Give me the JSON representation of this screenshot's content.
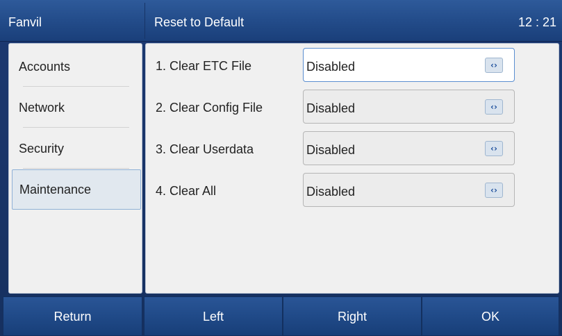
{
  "header": {
    "brand": "Fanvil",
    "title": "Reset to Default",
    "clock": "12 : 21"
  },
  "sidebar": {
    "items": [
      {
        "label": "Accounts"
      },
      {
        "label": "Network"
      },
      {
        "label": "Security"
      },
      {
        "label": "Maintenance",
        "active": true
      }
    ]
  },
  "main": {
    "rows": [
      {
        "label": "1. Clear ETC File",
        "value": "Disabled",
        "focused": true
      },
      {
        "label": "2. Clear Config File",
        "value": "Disabled"
      },
      {
        "label": "3. Clear Userdata",
        "value": "Disabled"
      },
      {
        "label": "4. Clear All",
        "value": "Disabled"
      }
    ],
    "arrow_glyph": "‹›"
  },
  "softkeys": {
    "return_label": "Return",
    "left_label": "Left",
    "right_label": "Right",
    "ok_label": "OK"
  },
  "colors": {
    "header_bg": "#234c8a",
    "panel_bg": "#f0f0f0",
    "active_item_bg": "#e1e8ef",
    "focus_border": "#5a8ed0"
  }
}
